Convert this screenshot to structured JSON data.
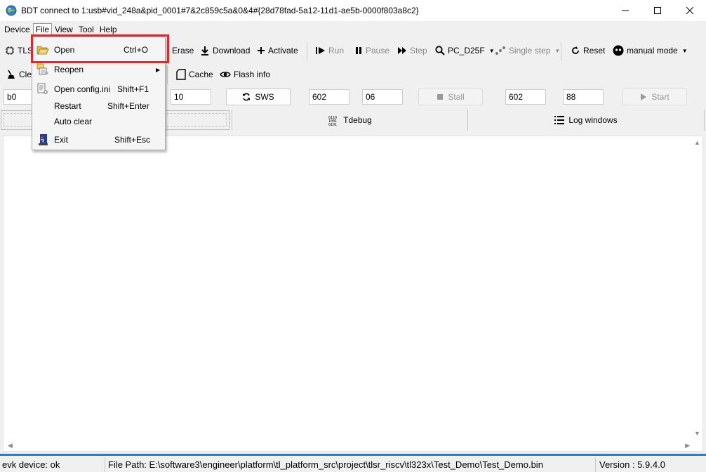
{
  "window": {
    "title": "BDT connect to 1:usb#vid_248a&pid_0001#7&2c859c5a&0&4#{28d78fad-5a12-11d1-ae5b-0000f803a8c2}",
    "app_icon": "globe-icon",
    "controls": [
      "minimize-icon",
      "maximize-icon",
      "close-icon"
    ]
  },
  "menubar": {
    "items": [
      {
        "label": "Device"
      },
      {
        "label": "File"
      },
      {
        "label": "View"
      },
      {
        "label": "Tool"
      },
      {
        "label": "Help"
      }
    ],
    "active": "File"
  },
  "toolbar1": {
    "chip_label": "TLS",
    "erase": "Erase",
    "download": "Download",
    "activate": "Activate",
    "run": "Run",
    "pause": "Pause",
    "step": "Step",
    "pc": "PC_D25F",
    "single_step": "Single step",
    "reset": "Reset",
    "mode": "manual mode"
  },
  "toolbar2": {
    "clear": "Clea",
    "cache": "Cache",
    "flash_info": "Flash info"
  },
  "inputs": {
    "field1": "b0",
    "field2": "10",
    "sws_button": "SWS",
    "field3": "602",
    "field4": "06",
    "stall_button": "Stall",
    "field5": "602",
    "field6": "88",
    "start_button": "Start"
  },
  "tabs": {
    "tdebug": "Tdebug",
    "log_windows": "Log windows"
  },
  "file_menu": {
    "items": [
      {
        "label": "Open",
        "shortcut": "Ctrl+O",
        "icon": "folder-open-icon"
      },
      {
        "label": "Reopen",
        "shortcut": "",
        "icon": "reopen-icon",
        "submenu": true
      },
      {
        "label": "Open config.ini",
        "shortcut": "Shift+F1",
        "icon": "config-file-icon"
      },
      {
        "label": "Restart",
        "shortcut": "Shift+Enter",
        "icon": ""
      },
      {
        "label": "Auto clear",
        "shortcut": "",
        "icon": ""
      },
      {
        "label": "Exit",
        "shortcut": "Shift+Esc",
        "icon": "exit-door-icon"
      }
    ],
    "highlighted": "Open"
  },
  "statusbar": {
    "device": "evk device: ok",
    "file_path": "File Path:  E:\\software3\\engineer\\platform\\tl_platform_src\\project\\tlsr_riscv\\tl323x\\Test_Demo\\Test_Demo.bin",
    "version": "Version : 5.9.4.0"
  },
  "colors": {
    "highlight_border": "#e0282f",
    "status_accent": "#2d7fc1"
  }
}
